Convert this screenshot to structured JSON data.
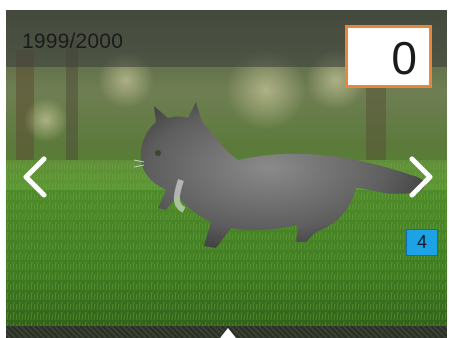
{
  "header": {
    "photo_counter": "1999/2000"
  },
  "copies": {
    "value": "0"
  },
  "photo": {
    "subject": "kitten-on-grass",
    "badge_number": "4"
  },
  "icons": {
    "prev": "chevron-left-icon",
    "next": "chevron-right-icon",
    "up": "caret-up-icon"
  },
  "colors": {
    "copies_border": "#e8873c",
    "badge_bg": "#1ba3e6"
  }
}
